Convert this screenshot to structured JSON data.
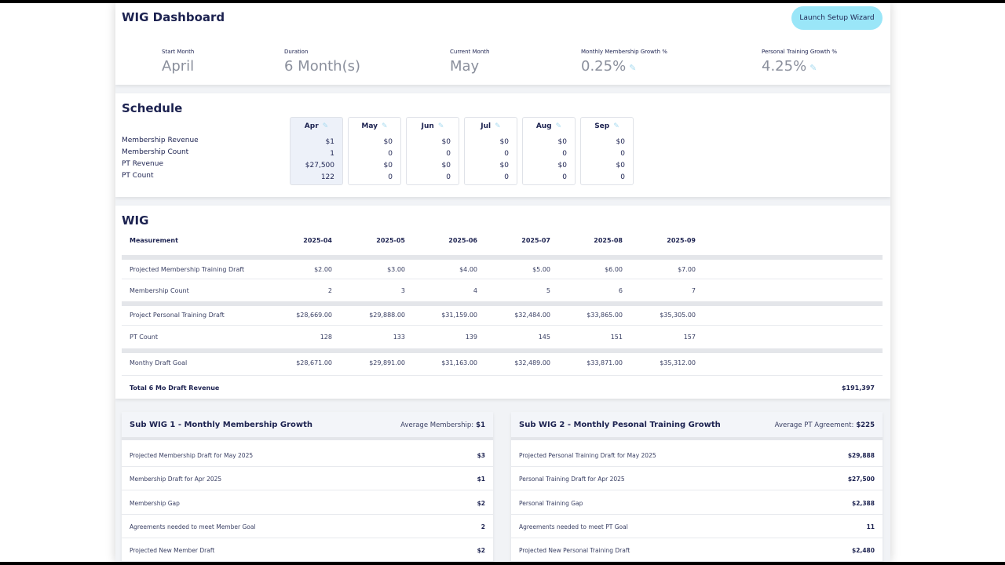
{
  "header": {
    "title": "WIG Dashboard",
    "setup_button": "Launch Setup Wizard",
    "stats": [
      {
        "label": "Start Month",
        "value": "April"
      },
      {
        "label": "Duration",
        "value": "6 Month(s)"
      },
      {
        "label": "Current Month",
        "value": "May"
      },
      {
        "label": "Monthly Membership Growth %",
        "value": "0.25%",
        "editable": true
      },
      {
        "label": "Personal Training Growth %",
        "value": "4.25%",
        "editable": true
      }
    ]
  },
  "schedule": {
    "title": "Schedule",
    "row_labels": [
      "Membership Revenue",
      "Membership Count",
      "PT Revenue",
      "PT Count"
    ],
    "months": [
      {
        "name": "Apr",
        "values": [
          "$1",
          "1",
          "$27,500",
          "122"
        ],
        "active": true
      },
      {
        "name": "May",
        "values": [
          "$0",
          "0",
          "$0",
          "0"
        ]
      },
      {
        "name": "Jun",
        "values": [
          "$0",
          "0",
          "$0",
          "0"
        ]
      },
      {
        "name": "Jul",
        "values": [
          "$0",
          "0",
          "$0",
          "0"
        ]
      },
      {
        "name": "Aug",
        "values": [
          "$0",
          "0",
          "$0",
          "0"
        ]
      },
      {
        "name": "Sep",
        "values": [
          "$0",
          "0",
          "$0",
          "0"
        ]
      }
    ],
    "edit_icon": "pencil-icon",
    "accent_color": "#a8dbf0"
  },
  "wig": {
    "title": "WIG",
    "measurement_header": "Measurement",
    "periods": [
      "2025-04",
      "2025-05",
      "2025-06",
      "2025-07",
      "2025-08",
      "2025-09"
    ],
    "rows": [
      {
        "label": "Projected Membership Training Draft",
        "values": [
          "$2.00",
          "$3.00",
          "$4.00",
          "$5.00",
          "$6.00",
          "$7.00"
        ]
      },
      {
        "label": "Membership Count",
        "values": [
          "2",
          "3",
          "4",
          "5",
          "6",
          "7"
        ]
      },
      {
        "label": "Project Personal Training Draft",
        "values": [
          "$28,669.00",
          "$29,888.00",
          "$31,159.00",
          "$32,484.00",
          "$33,865.00",
          "$35,305.00"
        ]
      },
      {
        "label": "PT Count",
        "values": [
          "128",
          "133",
          "139",
          "145",
          "151",
          "157"
        ]
      },
      {
        "label": "Monthy Draft Goal",
        "values": [
          "$28,671.00",
          "$29,891.00",
          "$31,163.00",
          "$32,489.00",
          "$33,871.00",
          "$35,312.00"
        ]
      }
    ],
    "total_label": "Total 6 Mo Draft Revenue",
    "total_value": "$191,397"
  },
  "subwig1": {
    "title": "Sub WIG 1 - Monthly Membership Growth",
    "avg_label": "Average Membership:",
    "avg_value": "$1",
    "rows": [
      {
        "label": "Projected Membership Draft for May 2025",
        "value": "$3"
      },
      {
        "label": "Membership Draft for Apr 2025",
        "value": "$1"
      },
      {
        "label": "Membership Gap",
        "value": "$2"
      },
      {
        "label": "Agreements needed to meet Member Goal",
        "value": "2"
      },
      {
        "label": "Projected New Member Draft",
        "value": "$2"
      }
    ]
  },
  "subwig2": {
    "title": "Sub WIG 2 - Monthly Pesonal Training Growth",
    "avg_label": "Average PT Agreement:",
    "avg_value": "$225",
    "rows": [
      {
        "label": "Projected Personal Training Draft for May 2025",
        "value": "$29,888"
      },
      {
        "label": "Personal Training Draft for Apr 2025",
        "value": "$27,500"
      },
      {
        "label": "Personal Training Gap",
        "value": "$2,388"
      },
      {
        "label": "Agreements needed to meet PT Goal",
        "value": "11"
      },
      {
        "label": "Projected New Personal Training Draft",
        "value": "$2,480"
      }
    ]
  }
}
